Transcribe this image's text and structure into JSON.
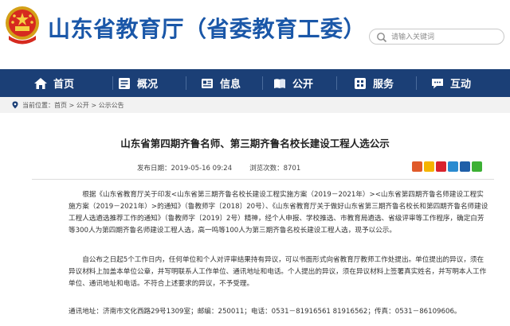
{
  "header": {
    "site_title": "山东省教育厅（省委教育工委）",
    "search_placeholder": "请输入关键词",
    "emblem_icon": "national-emblem-icon",
    "accent_color": "#1a57a8"
  },
  "nav": {
    "background": "#1b3f76",
    "items": [
      {
        "label": "首页",
        "icon": "home-icon"
      },
      {
        "label": "概况",
        "icon": "overview-icon"
      },
      {
        "label": "信息",
        "icon": "info-icon"
      },
      {
        "label": "公开",
        "icon": "book-icon"
      },
      {
        "label": "服务",
        "icon": "service-icon"
      },
      {
        "label": "互动",
        "icon": "chat-icon"
      }
    ]
  },
  "breadcrumb": {
    "prefix": "当前位置：",
    "path": "首页 > 公开 > 公示公告"
  },
  "article": {
    "title": "山东省第四期齐鲁名师、第三期齐鲁名校长建设工程人选公示",
    "publish_label": "发布日期：2019-05-16 09:24",
    "views_label": "浏览次数：8701",
    "paragraphs": [
      "根据《山东省教育厅关于印发<山东省第三期齐鲁名校长建设工程实施方案（2019－2021年）><山东省第四期齐鲁名师建设工程实施方案（2019－2021年）>的通知》（鲁教师字〔2018〕20号）、《山东省教育厅关于做好山东省第三期齐鲁名校长和第四期齐鲁名师建设工程人选遴选推荐工作的通知》（鲁教师字〔2019〕2号）精神，经个人申报、学校推选、市教育局遴选、省级评审等工作程序，确定白芳等300人为第四期齐鲁名师建设工程人选，高一鸣等100人为第三期齐鲁名校长建设工程人选，现予以公示。",
      "自公布之日起5个工作日内，任何单位和个人对评审结果持有异议，可以书面形式向省教育厅教师工作处提出。单位提出的异议，须在异议材料上加盖本单位公章，并写明联系人工作单位、通讯地址和电话。个人提出的异议，须在异议材料上签署真实姓名，并写明本人工作单位、通讯地址和电话。不符合上述要求的异议，不予受理。",
      "通讯地址：济南市文化西路29号1309室；邮编：250011；电话：0531－81916561  81916562；传真：0531－86109606。"
    ]
  },
  "share": {
    "icons": [
      "share-more-icon",
      "qzone-icon",
      "weibo-icon",
      "tencent-weibo-icon",
      "renren-icon",
      "wechat-icon"
    ],
    "colors": [
      "#e05a2a",
      "#f5b400",
      "#d9232e",
      "#2a8bd0",
      "#1f5fa8",
      "#3cb034"
    ]
  }
}
